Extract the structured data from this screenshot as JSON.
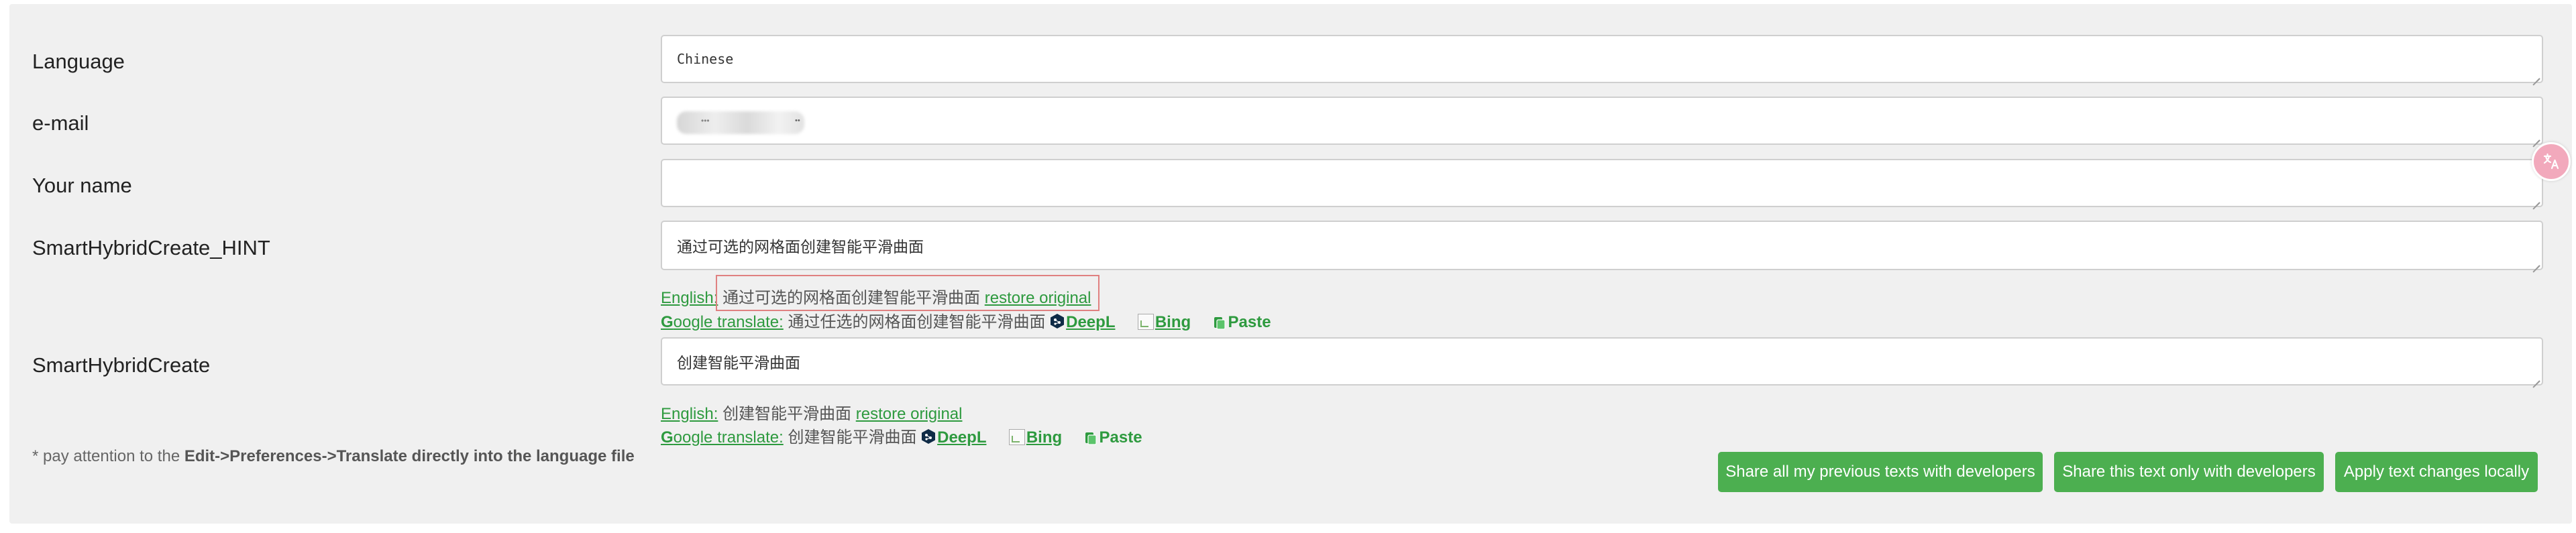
{
  "form": {
    "language": {
      "label": "Language",
      "value": "Chinese"
    },
    "email": {
      "label": "e-mail",
      "value_hint": "•••",
      "value_tail": "••"
    },
    "your_name": {
      "label": "Your name",
      "value": ""
    },
    "hint_field": {
      "label": "SmartHybridCreate_HINT",
      "value": "通过可选的网格面创建智能平滑曲面",
      "english_label": "English:",
      "english_text": "通过可选的网格面创建智能平滑曲面",
      "restore": "restore original",
      "google_g": "G",
      "google_label": "oogle translate:",
      "google_text": "通过任选的网格面创建智能平滑曲面",
      "deepl": "DeepL",
      "bing": "Bing",
      "paste": "Paste"
    },
    "create_field": {
      "label": "SmartHybridCreate",
      "value": "创建智能平滑曲面",
      "english_label": "English:",
      "english_text": "创建智能平滑曲面",
      "restore": "restore original",
      "google_g": "G",
      "google_label": "oogle translate:",
      "google_text": "创建智能平滑曲面",
      "deepl": "DeepL",
      "bing": "Bing",
      "paste": "Paste"
    }
  },
  "note": {
    "prefix": "* pay attention to the ",
    "bold": "Edit->Preferences->Translate directly into the language file"
  },
  "buttons": {
    "share_all": "Share all my previous texts with developers",
    "share_this": "Share this text only with developers",
    "apply": "Apply text changes locally"
  },
  "colors": {
    "accent": "#4caf50",
    "link": "#2e9a3f",
    "panel": "#f0f0f0",
    "highlight_box": "#e08080"
  },
  "icons": [
    "deepl-icon",
    "bing-icon",
    "paste-icon",
    "translate-icon"
  ]
}
